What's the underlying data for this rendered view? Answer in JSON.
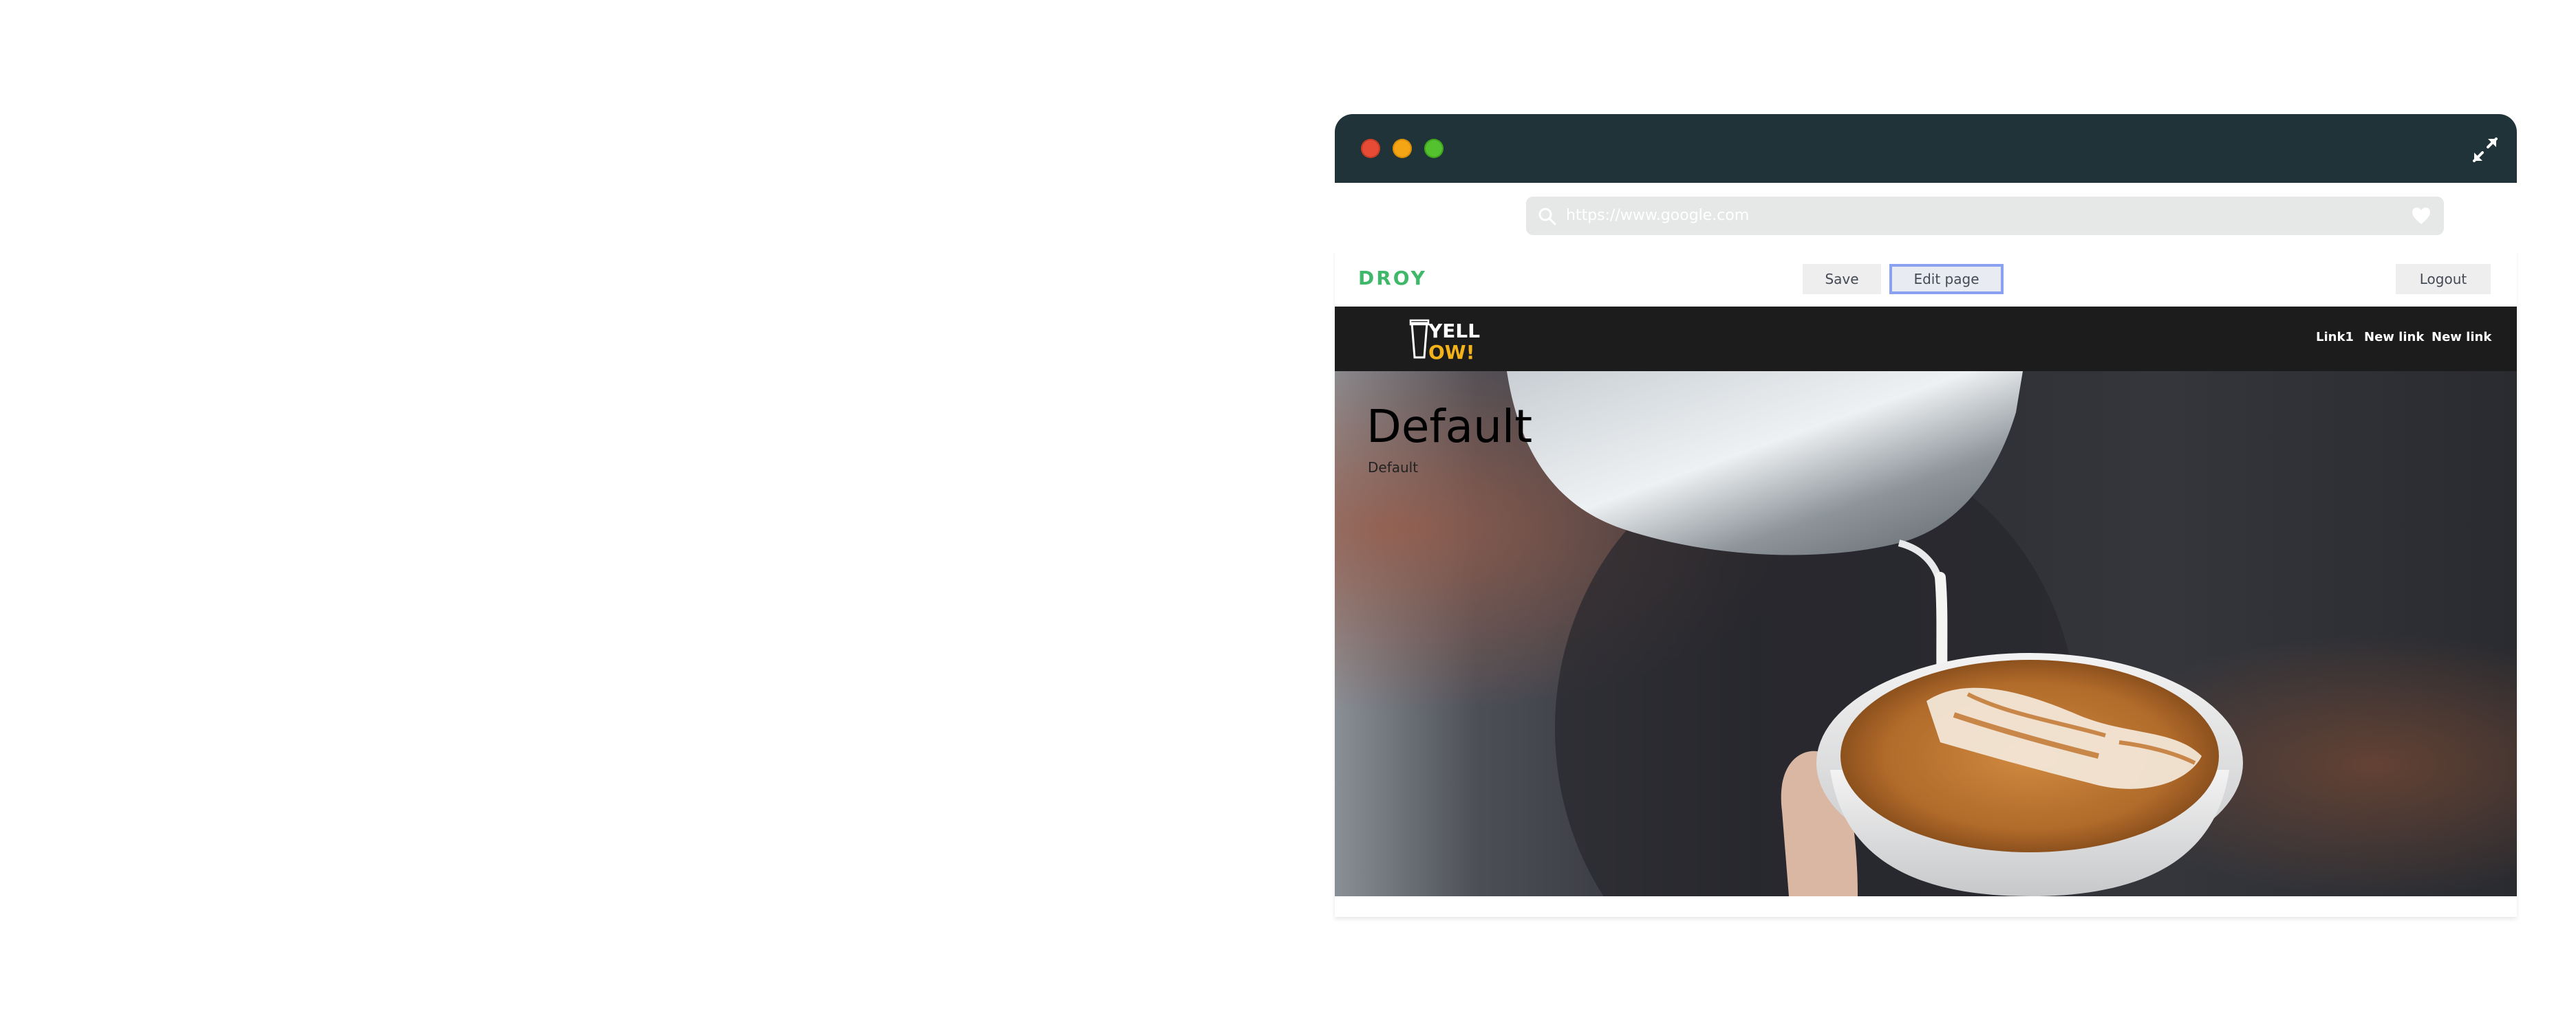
{
  "window": {
    "controls": [
      "close",
      "minimize",
      "maximize"
    ],
    "expand_icon": "expand-icon"
  },
  "address_bar": {
    "url": "https://www.google.com",
    "search_icon": "search-icon",
    "favorite_icon": "heart-icon"
  },
  "toolbar": {
    "brand": "DROY",
    "save_label": "Save",
    "edit_label": "Edit page",
    "logout_label": "Logout",
    "brand_color": "#3fb86a",
    "edit_highlight_color": "#8aa0f0"
  },
  "site": {
    "logo": {
      "line1": "YELL",
      "line2": "OW!",
      "accent_color": "#f3b21a"
    },
    "nav_links": [
      "Link1",
      "New link",
      "New link"
    ],
    "hero": {
      "title": "Default",
      "subtitle": "Default",
      "image": "latte-art-photo"
    }
  }
}
